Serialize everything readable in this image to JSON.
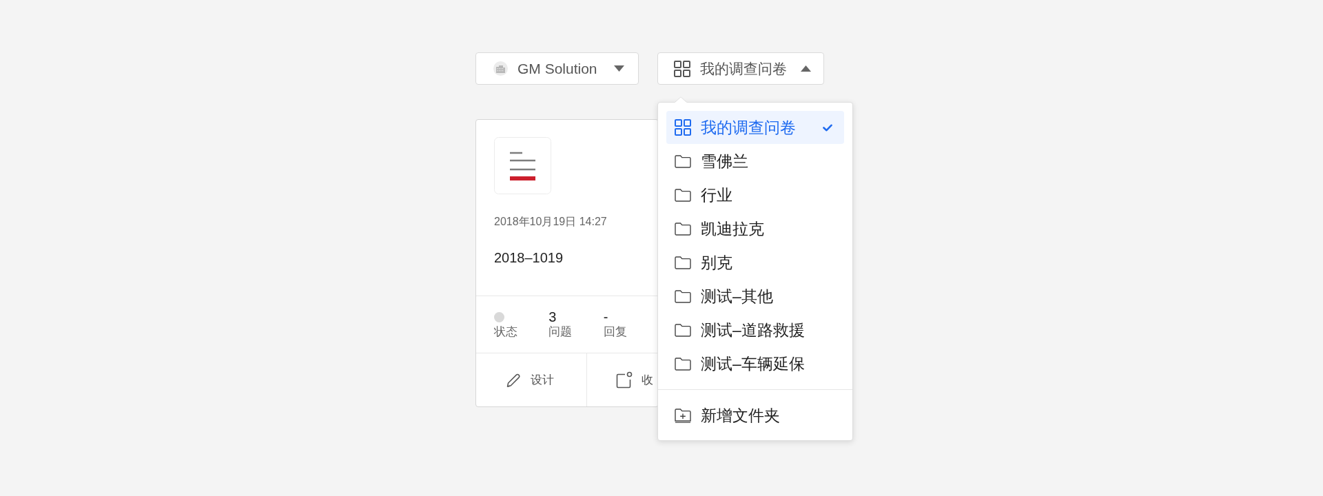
{
  "toolbar": {
    "workspace_button": {
      "label": "GM Solution",
      "expanded": false
    },
    "folder_button": {
      "label": "我的调查问卷",
      "expanded": true
    }
  },
  "card": {
    "date": "2018年10月19日 14:27",
    "title": "2018–1019",
    "stats": [
      {
        "kind": "status",
        "label": "状态",
        "color": "#d9d9d9"
      },
      {
        "kind": "count",
        "value": "3",
        "label": "问题"
      },
      {
        "kind": "count",
        "value": "-",
        "label": "回复"
      }
    ],
    "actions": [
      {
        "kind": "design",
        "label": "设计"
      },
      {
        "kind": "collect",
        "label": "收"
      }
    ]
  },
  "folder_menu": {
    "items": [
      {
        "kind": "all",
        "label": "我的调查问卷",
        "selected": true
      },
      {
        "kind": "folder",
        "label": "雪佛兰",
        "selected": false
      },
      {
        "kind": "folder",
        "label": "行业",
        "selected": false
      },
      {
        "kind": "folder",
        "label": "凯迪拉克",
        "selected": false
      },
      {
        "kind": "folder",
        "label": "别克",
        "selected": false
      },
      {
        "kind": "folder",
        "label": "测试–其他",
        "selected": false
      },
      {
        "kind": "folder",
        "label": "测试–道路救援",
        "selected": false
      },
      {
        "kind": "folder",
        "label": "测试–车辆延保",
        "selected": false
      }
    ],
    "footer": {
      "label": "新增文件夹"
    }
  }
}
